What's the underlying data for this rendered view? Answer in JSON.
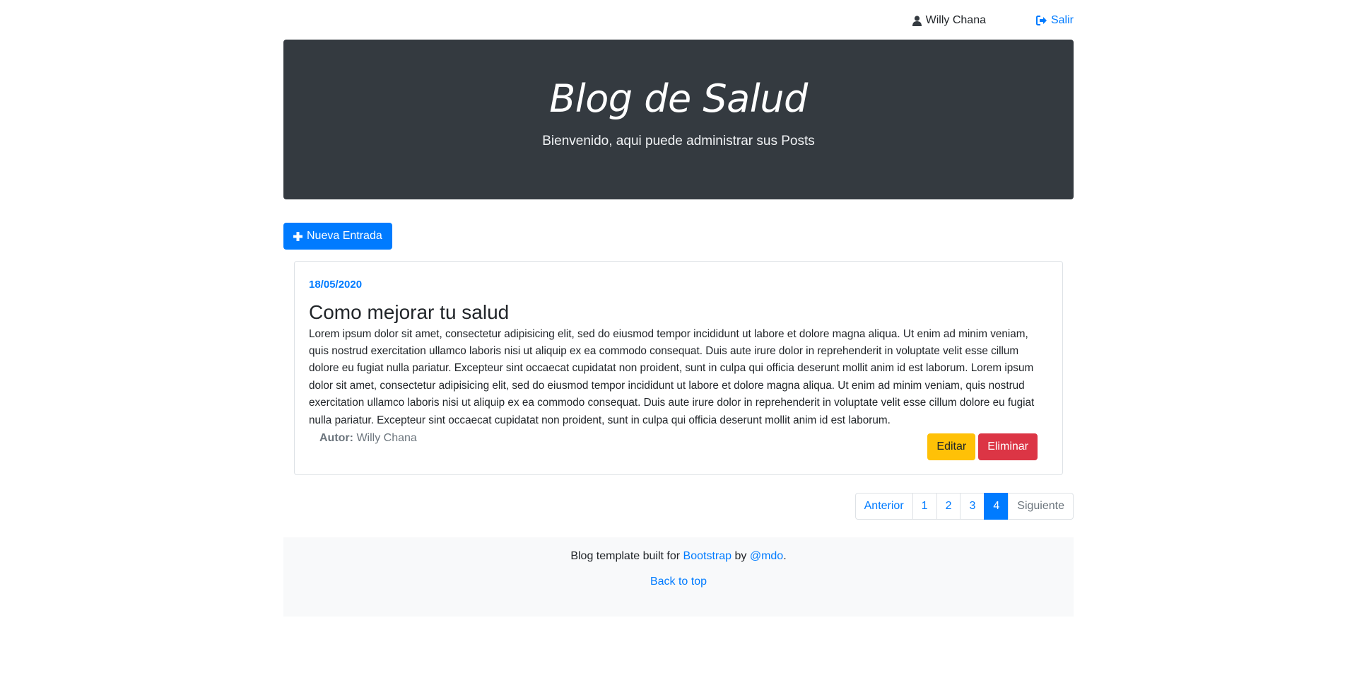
{
  "header": {
    "user_name": "Willy Chana",
    "logout_label": "Salir"
  },
  "hero": {
    "title": "Blog de Salud",
    "subtitle": "Bienvenido, aqui puede administrar sus Posts"
  },
  "actions": {
    "new_entry_label": "Nueva Entrada"
  },
  "post": {
    "date": "18/05/2020",
    "title": "Como mejorar tu salud",
    "body": "Lorem ipsum dolor sit amet, consectetur adipisicing elit, sed do eiusmod tempor incididunt ut labore et dolore magna aliqua. Ut enim ad minim veniam, quis nostrud exercitation ullamco laboris nisi ut aliquip ex ea commodo consequat. Duis aute irure dolor in reprehenderit in voluptate velit esse cillum dolore eu fugiat nulla pariatur. Excepteur sint occaecat cupidatat non proident, sunt in culpa qui officia deserunt mollit anim id est laborum. Lorem ipsum dolor sit amet, consectetur adipisicing elit, sed do eiusmod tempor incididunt ut labore et dolore magna aliqua. Ut enim ad minim veniam, quis nostrud exercitation ullamco laboris nisi ut aliquip ex ea commodo consequat. Duis aute irure dolor in reprehenderit in voluptate velit esse cillum dolore eu fugiat nulla pariatur. Excepteur sint occaecat cupidatat non proident, sunt in culpa qui officia deserunt mollit anim id est laborum.",
    "author_label": "Autor:",
    "author_name": "Willy Chana",
    "edit_label": "Editar",
    "delete_label": "Eliminar"
  },
  "pagination": {
    "prev_label": "Anterior",
    "pages": [
      "1",
      "2",
      "3",
      "4"
    ],
    "active_page": "4",
    "next_label": "Siguiente"
  },
  "footer": {
    "text_before": "Blog template built for",
    "bootstrap_link": "Bootstrap",
    "by_text": "by",
    "author_link": "@mdo",
    "period": ".",
    "back_to_top": "Back to top"
  },
  "colors": {
    "primary": "#007bff",
    "dark": "#343a40",
    "warning": "#ffc107",
    "danger": "#dc3545",
    "light": "#f8f9fa"
  }
}
